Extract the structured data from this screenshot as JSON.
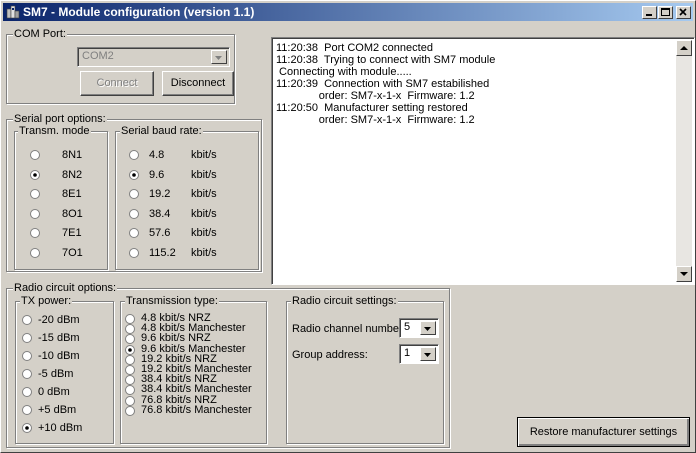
{
  "window": {
    "title": "SM7 - Module configuration (version 1.1)"
  },
  "com_port": {
    "group_label": "COM Port:",
    "selected": "COM2",
    "connect_label": "Connect",
    "disconnect_label": "Disconnect"
  },
  "serial_options": {
    "group_label": "Serial port options:",
    "transm_mode": {
      "label": "Transm. mode",
      "options": [
        "8N1",
        "8N2",
        "8E1",
        "8O1",
        "7E1",
        "7O1"
      ],
      "selected_index": 1
    },
    "baud": {
      "label": "Serial baud rate:",
      "options": [
        "4.8",
        "9.6",
        "19.2",
        "38.4",
        "57.6",
        "115.2"
      ],
      "unit": "kbit/s",
      "selected_index": 1
    }
  },
  "log": {
    "lines": [
      "11:20:38  Port COM2 connected",
      "11:20:38  Trying to connect with SM7 module",
      " Connecting with module.....",
      "11:20:39  Connection with SM7 estabilished",
      "              order: SM7-x-1-x  Firmware: 1.2",
      "11:20:50  Manufacturer setting restored",
      "              order: SM7-x-1-x  Firmware: 1.2"
    ]
  },
  "radio_options": {
    "group_label": "Radio circuit options:",
    "tx_power": {
      "label": "TX power:",
      "options": [
        "-20  dBm",
        "-15  dBm",
        "-10  dBm",
        "-5  dBm",
        "0  dBm",
        "+5  dBm",
        "+10  dBm"
      ],
      "selected_index": 6
    },
    "transmission": {
      "label": "Transmission type:",
      "options": [
        "4.8  kbit/s NRZ",
        "4.8  kbit/s Manchester",
        "9.6  kbit/s NRZ",
        "9.6  kbit/s Manchester",
        "19.2 kbit/s NRZ",
        "19.2 kbit/s Manchester",
        "38.4 kbit/s NRZ",
        "38.4 kbit/s Manchester",
        "76.8 kbit/s NRZ",
        "76.8 kbit/s Manchester"
      ],
      "selected_index": 3
    },
    "settings": {
      "label": "Radio circuit settings:",
      "channel_label": "Radio channel number:",
      "channel_value": "5",
      "group_label": "Group address:",
      "group_value": "1"
    }
  },
  "restore_label": "Restore manufacturer settings"
}
